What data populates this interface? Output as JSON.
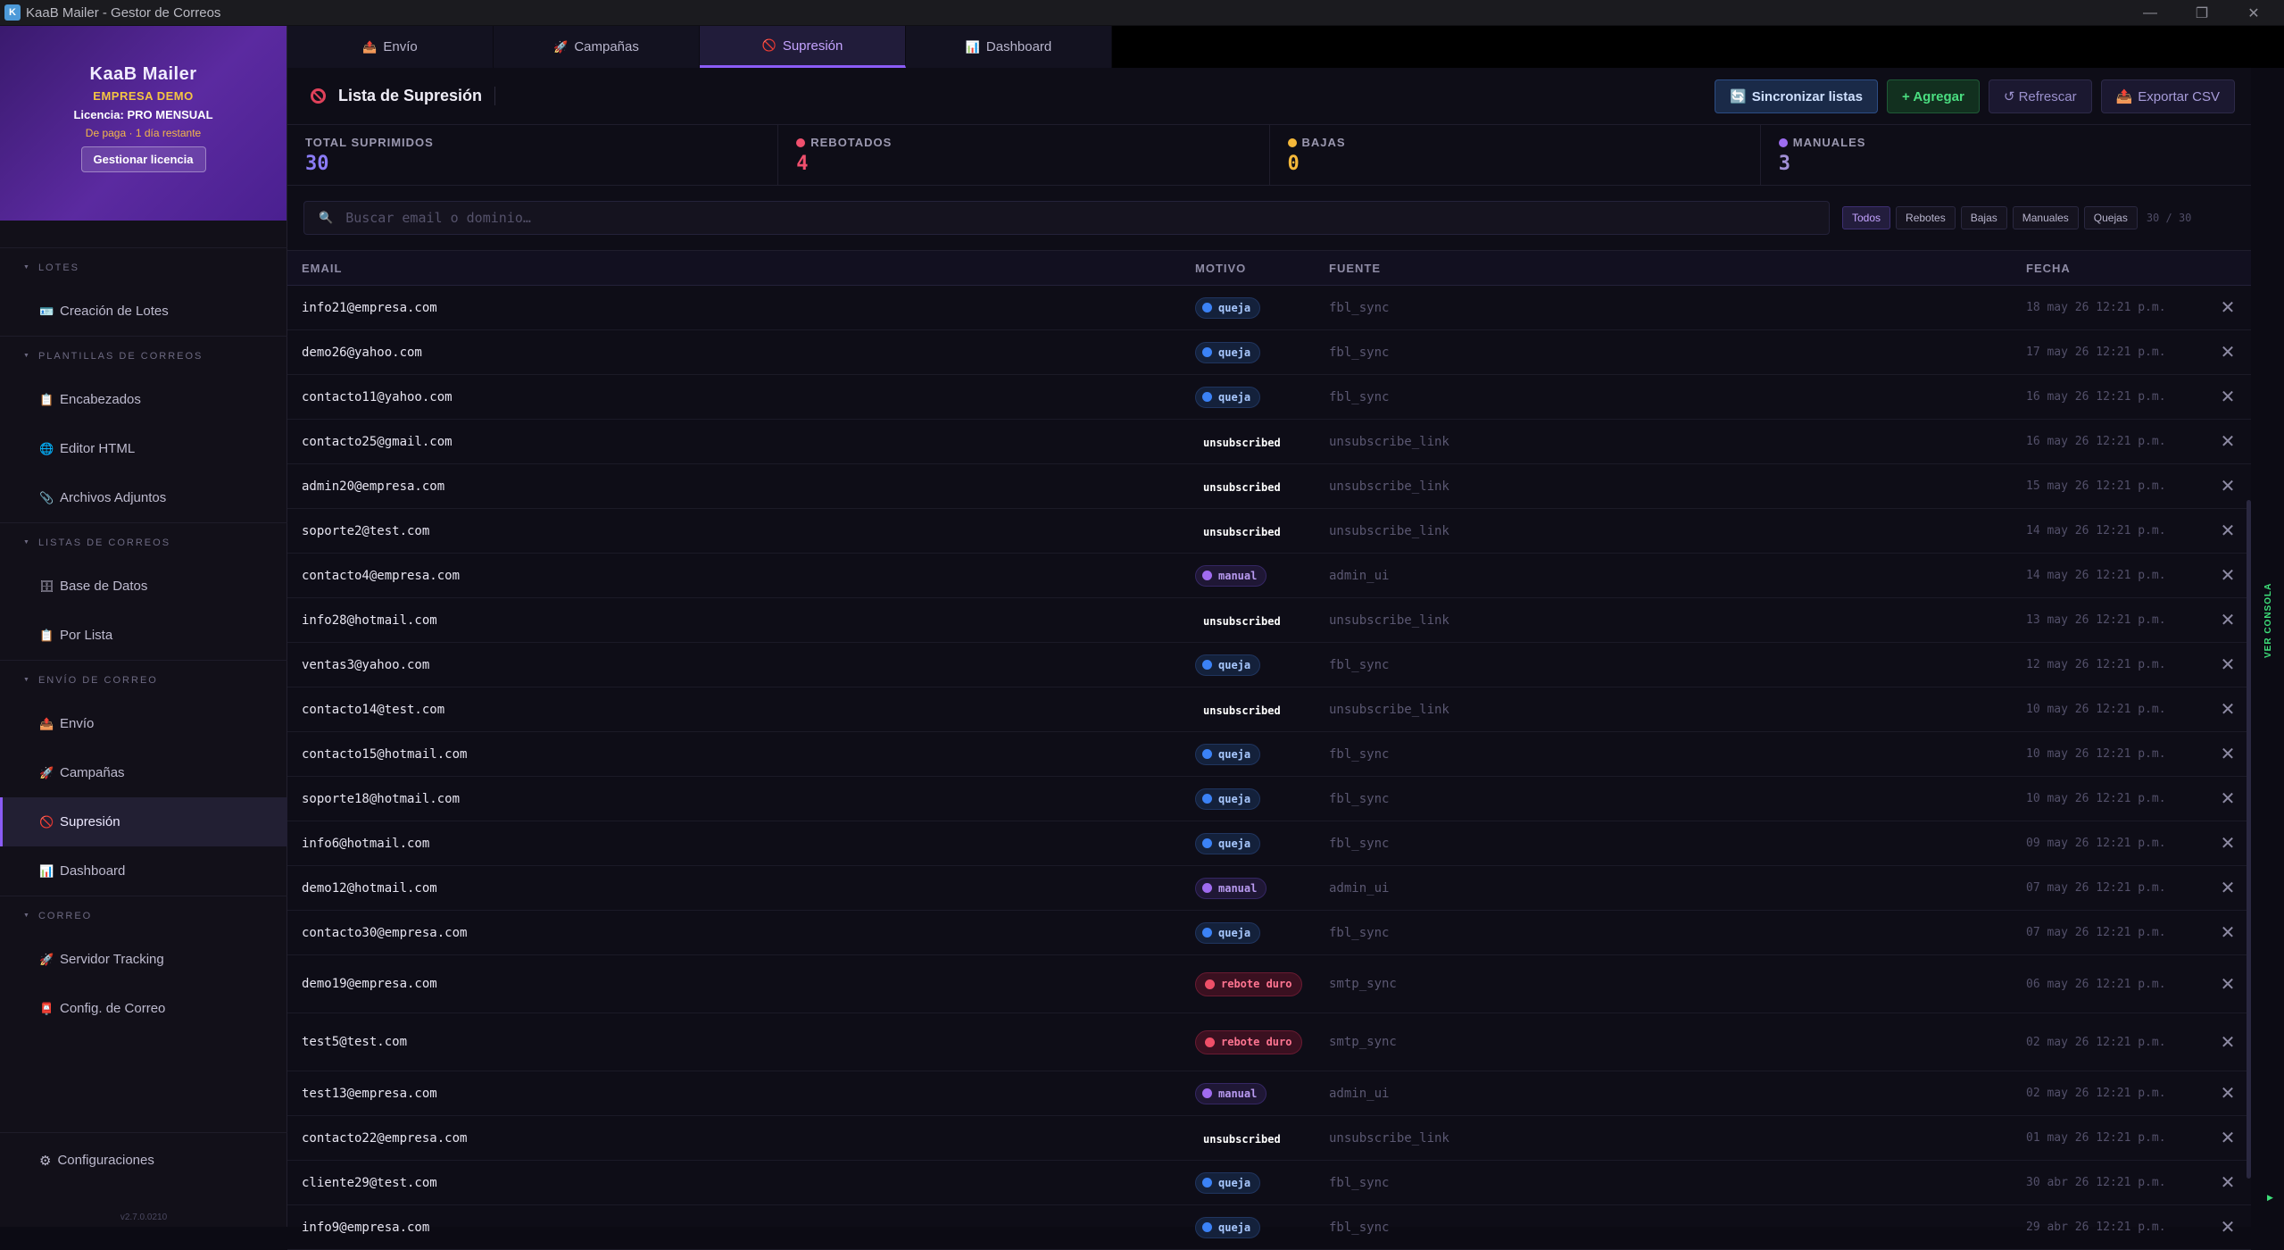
{
  "window": {
    "title": "KaaB Mailer - Gestor de Correos",
    "minimize": "—",
    "maximize": "❐",
    "close": "✕"
  },
  "brand": {
    "name": "KaaB Mailer",
    "company": "EMPRESA DEMO",
    "license": "Licencia: PRO MENSUAL",
    "paid_status": "De paga · 1 día restante",
    "manage_label": "Gestionar licencia"
  },
  "sidebar": {
    "sections": [
      {
        "title": "LOTES",
        "items": [
          {
            "label": "Creación de Lotes",
            "icon": "🪪"
          }
        ]
      },
      {
        "title": "PLANTILLAS DE CORREOS",
        "items": [
          {
            "label": "Encabezados",
            "icon": "📋"
          },
          {
            "label": "Editor HTML",
            "icon": "🌐"
          },
          {
            "label": "Archivos Adjuntos",
            "icon": "📎"
          }
        ]
      },
      {
        "title": "LISTAS DE CORREOS",
        "items": [
          {
            "label": "Base de Datos",
            "icon": "🗄"
          },
          {
            "label": "Por Lista",
            "icon": "📋"
          }
        ]
      },
      {
        "title": "ENVÍO DE CORREO",
        "items": [
          {
            "label": "Envío",
            "icon": "📤"
          },
          {
            "label": "Campañas",
            "icon": "🚀"
          },
          {
            "label": "Supresión",
            "icon": "🚫"
          },
          {
            "label": "Dashboard",
            "icon": "📊"
          }
        ]
      },
      {
        "title": "CORREO",
        "items": [
          {
            "label": "Servidor Tracking",
            "icon": "🚀"
          },
          {
            "label": "Config. de Correo",
            "icon": "📮"
          }
        ]
      }
    ],
    "settings_label": "Configuraciones",
    "version": "v2.7.0.0210"
  },
  "tabs": [
    {
      "label": "Envío",
      "icon": "📤"
    },
    {
      "label": "Campañas",
      "icon": "🚀"
    },
    {
      "label": "Supresión",
      "icon": "🚫"
    },
    {
      "label": "Dashboard",
      "icon": "📊"
    }
  ],
  "header": {
    "title": "Lista de Supresión",
    "sync_label": "Sincronizar listas",
    "add_label": "+ Agregar",
    "refresh_label": "↺ Refrescar",
    "export_label": "Exportar CSV"
  },
  "stats": [
    {
      "label": "TOTAL SUPRIMIDOS",
      "value": "30",
      "color": "#8b7cf6",
      "dot": ""
    },
    {
      "label": "REBOTADOS",
      "value": "4",
      "color": "#f0506e",
      "dot": "#f0506e"
    },
    {
      "label": "BAJAS",
      "value": "0",
      "color": "#f5b83a",
      "dot": "#f5b83a"
    },
    {
      "label": "MANUALES",
      "value": "3",
      "color": "#a18fd6",
      "dot": "#9d6cf0"
    }
  ],
  "search": {
    "placeholder": "Buscar email o dominio…"
  },
  "filters": [
    "Todos",
    "Rebotes",
    "Bajas",
    "Manuales",
    "Quejas"
  ],
  "count": "30 / 30",
  "columns": {
    "email": "EMAIL",
    "motivo": "MOTIVO",
    "fuente": "FUENTE",
    "fecha": "FECHA"
  },
  "rows": [
    {
      "email": "info21@empresa.com",
      "motivo": "queja",
      "fuente": "fbl_sync",
      "fecha": "18 may 26 12:21 p.m."
    },
    {
      "email": "demo26@yahoo.com",
      "motivo": "queja",
      "fuente": "fbl_sync",
      "fecha": "17 may 26 12:21 p.m."
    },
    {
      "email": "contacto11@yahoo.com",
      "motivo": "queja",
      "fuente": "fbl_sync",
      "fecha": "16 may 26 12:21 p.m."
    },
    {
      "email": "contacto25@gmail.com",
      "motivo": "unsubscribed",
      "fuente": "unsubscribe_link",
      "fecha": "16 may 26 12:21 p.m."
    },
    {
      "email": "admin20@empresa.com",
      "motivo": "unsubscribed",
      "fuente": "unsubscribe_link",
      "fecha": "15 may 26 12:21 p.m."
    },
    {
      "email": "soporte2@test.com",
      "motivo": "unsubscribed",
      "fuente": "unsubscribe_link",
      "fecha": "14 may 26 12:21 p.m."
    },
    {
      "email": "contacto4@empresa.com",
      "motivo": "manual",
      "fuente": "admin_ui",
      "fecha": "14 may 26 12:21 p.m."
    },
    {
      "email": "info28@hotmail.com",
      "motivo": "unsubscribed",
      "fuente": "unsubscribe_link",
      "fecha": "13 may 26 12:21 p.m."
    },
    {
      "email": "ventas3@yahoo.com",
      "motivo": "queja",
      "fuente": "fbl_sync",
      "fecha": "12 may 26 12:21 p.m."
    },
    {
      "email": "contacto14@test.com",
      "motivo": "unsubscribed",
      "fuente": "unsubscribe_link",
      "fecha": "10 may 26 12:21 p.m."
    },
    {
      "email": "contacto15@hotmail.com",
      "motivo": "queja",
      "fuente": "fbl_sync",
      "fecha": "10 may 26 12:21 p.m."
    },
    {
      "email": "soporte18@hotmail.com",
      "motivo": "queja",
      "fuente": "fbl_sync",
      "fecha": "10 may 26 12:21 p.m."
    },
    {
      "email": "info6@hotmail.com",
      "motivo": "queja",
      "fuente": "fbl_sync",
      "fecha": "09 may 26 12:21 p.m."
    },
    {
      "email": "demo12@hotmail.com",
      "motivo": "manual",
      "fuente": "admin_ui",
      "fecha": "07 may 26 12:21 p.m."
    },
    {
      "email": "contacto30@empresa.com",
      "motivo": "queja",
      "fuente": "fbl_sync",
      "fecha": "07 may 26 12:21 p.m."
    },
    {
      "email": "demo19@empresa.com",
      "motivo": "rebote duro",
      "fuente": "smtp_sync",
      "fecha": "06 may 26 12:21 p.m."
    },
    {
      "email": "test5@test.com",
      "motivo": "rebote duro",
      "fuente": "smtp_sync",
      "fecha": "02 may 26 12:21 p.m."
    },
    {
      "email": "test13@empresa.com",
      "motivo": "manual",
      "fuente": "admin_ui",
      "fecha": "02 may 26 12:21 p.m."
    },
    {
      "email": "contacto22@empresa.com",
      "motivo": "unsubscribed",
      "fuente": "unsubscribe_link",
      "fecha": "01 may 26 12:21 p.m."
    },
    {
      "email": "cliente29@test.com",
      "motivo": "queja",
      "fuente": "fbl_sync",
      "fecha": "30 abr 26 12:21 p.m."
    },
    {
      "email": "info9@empresa.com",
      "motivo": "queja",
      "fuente": "fbl_sync",
      "fecha": "29 abr 26 12:21 p.m."
    }
  ],
  "console_label": "VER CONSOLA"
}
